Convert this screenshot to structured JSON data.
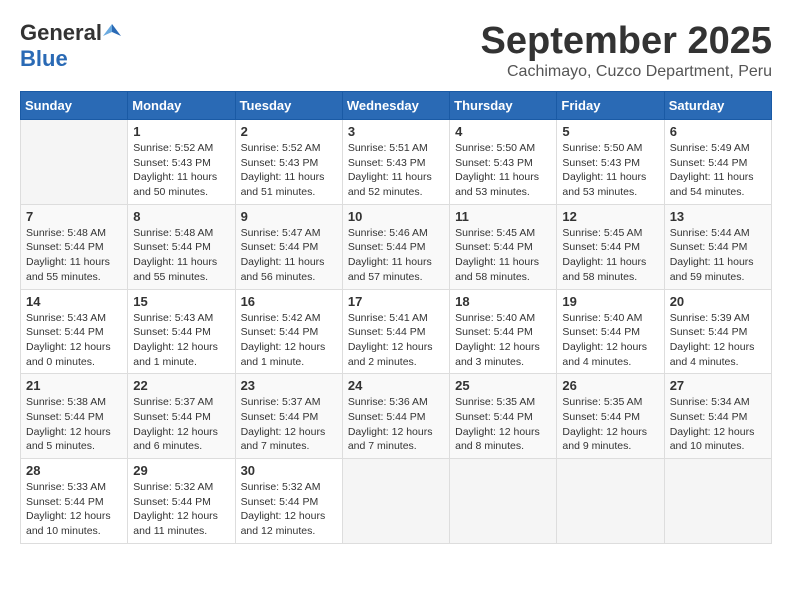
{
  "header": {
    "logo_general": "General",
    "logo_blue": "Blue",
    "month": "September 2025",
    "location": "Cachimayo, Cuzco Department, Peru"
  },
  "days_of_week": [
    "Sunday",
    "Monday",
    "Tuesday",
    "Wednesday",
    "Thursday",
    "Friday",
    "Saturday"
  ],
  "weeks": [
    [
      {
        "day": "",
        "info": ""
      },
      {
        "day": "1",
        "info": "Sunrise: 5:52 AM\nSunset: 5:43 PM\nDaylight: 11 hours\nand 50 minutes."
      },
      {
        "day": "2",
        "info": "Sunrise: 5:52 AM\nSunset: 5:43 PM\nDaylight: 11 hours\nand 51 minutes."
      },
      {
        "day": "3",
        "info": "Sunrise: 5:51 AM\nSunset: 5:43 PM\nDaylight: 11 hours\nand 52 minutes."
      },
      {
        "day": "4",
        "info": "Sunrise: 5:50 AM\nSunset: 5:43 PM\nDaylight: 11 hours\nand 53 minutes."
      },
      {
        "day": "5",
        "info": "Sunrise: 5:50 AM\nSunset: 5:43 PM\nDaylight: 11 hours\nand 53 minutes."
      },
      {
        "day": "6",
        "info": "Sunrise: 5:49 AM\nSunset: 5:44 PM\nDaylight: 11 hours\nand 54 minutes."
      }
    ],
    [
      {
        "day": "7",
        "info": "Sunrise: 5:48 AM\nSunset: 5:44 PM\nDaylight: 11 hours\nand 55 minutes."
      },
      {
        "day": "8",
        "info": "Sunrise: 5:48 AM\nSunset: 5:44 PM\nDaylight: 11 hours\nand 55 minutes."
      },
      {
        "day": "9",
        "info": "Sunrise: 5:47 AM\nSunset: 5:44 PM\nDaylight: 11 hours\nand 56 minutes."
      },
      {
        "day": "10",
        "info": "Sunrise: 5:46 AM\nSunset: 5:44 PM\nDaylight: 11 hours\nand 57 minutes."
      },
      {
        "day": "11",
        "info": "Sunrise: 5:45 AM\nSunset: 5:44 PM\nDaylight: 11 hours\nand 58 minutes."
      },
      {
        "day": "12",
        "info": "Sunrise: 5:45 AM\nSunset: 5:44 PM\nDaylight: 11 hours\nand 58 minutes."
      },
      {
        "day": "13",
        "info": "Sunrise: 5:44 AM\nSunset: 5:44 PM\nDaylight: 11 hours\nand 59 minutes."
      }
    ],
    [
      {
        "day": "14",
        "info": "Sunrise: 5:43 AM\nSunset: 5:44 PM\nDaylight: 12 hours\nand 0 minutes."
      },
      {
        "day": "15",
        "info": "Sunrise: 5:43 AM\nSunset: 5:44 PM\nDaylight: 12 hours\nand 1 minute."
      },
      {
        "day": "16",
        "info": "Sunrise: 5:42 AM\nSunset: 5:44 PM\nDaylight: 12 hours\nand 1 minute."
      },
      {
        "day": "17",
        "info": "Sunrise: 5:41 AM\nSunset: 5:44 PM\nDaylight: 12 hours\nand 2 minutes."
      },
      {
        "day": "18",
        "info": "Sunrise: 5:40 AM\nSunset: 5:44 PM\nDaylight: 12 hours\nand 3 minutes."
      },
      {
        "day": "19",
        "info": "Sunrise: 5:40 AM\nSunset: 5:44 PM\nDaylight: 12 hours\nand 4 minutes."
      },
      {
        "day": "20",
        "info": "Sunrise: 5:39 AM\nSunset: 5:44 PM\nDaylight: 12 hours\nand 4 minutes."
      }
    ],
    [
      {
        "day": "21",
        "info": "Sunrise: 5:38 AM\nSunset: 5:44 PM\nDaylight: 12 hours\nand 5 minutes."
      },
      {
        "day": "22",
        "info": "Sunrise: 5:37 AM\nSunset: 5:44 PM\nDaylight: 12 hours\nand 6 minutes."
      },
      {
        "day": "23",
        "info": "Sunrise: 5:37 AM\nSunset: 5:44 PM\nDaylight: 12 hours\nand 7 minutes."
      },
      {
        "day": "24",
        "info": "Sunrise: 5:36 AM\nSunset: 5:44 PM\nDaylight: 12 hours\nand 7 minutes."
      },
      {
        "day": "25",
        "info": "Sunrise: 5:35 AM\nSunset: 5:44 PM\nDaylight: 12 hours\nand 8 minutes."
      },
      {
        "day": "26",
        "info": "Sunrise: 5:35 AM\nSunset: 5:44 PM\nDaylight: 12 hours\nand 9 minutes."
      },
      {
        "day": "27",
        "info": "Sunrise: 5:34 AM\nSunset: 5:44 PM\nDaylight: 12 hours\nand 10 minutes."
      }
    ],
    [
      {
        "day": "28",
        "info": "Sunrise: 5:33 AM\nSunset: 5:44 PM\nDaylight: 12 hours\nand 10 minutes."
      },
      {
        "day": "29",
        "info": "Sunrise: 5:32 AM\nSunset: 5:44 PM\nDaylight: 12 hours\nand 11 minutes."
      },
      {
        "day": "30",
        "info": "Sunrise: 5:32 AM\nSunset: 5:44 PM\nDaylight: 12 hours\nand 12 minutes."
      },
      {
        "day": "",
        "info": ""
      },
      {
        "day": "",
        "info": ""
      },
      {
        "day": "",
        "info": ""
      },
      {
        "day": "",
        "info": ""
      }
    ]
  ]
}
